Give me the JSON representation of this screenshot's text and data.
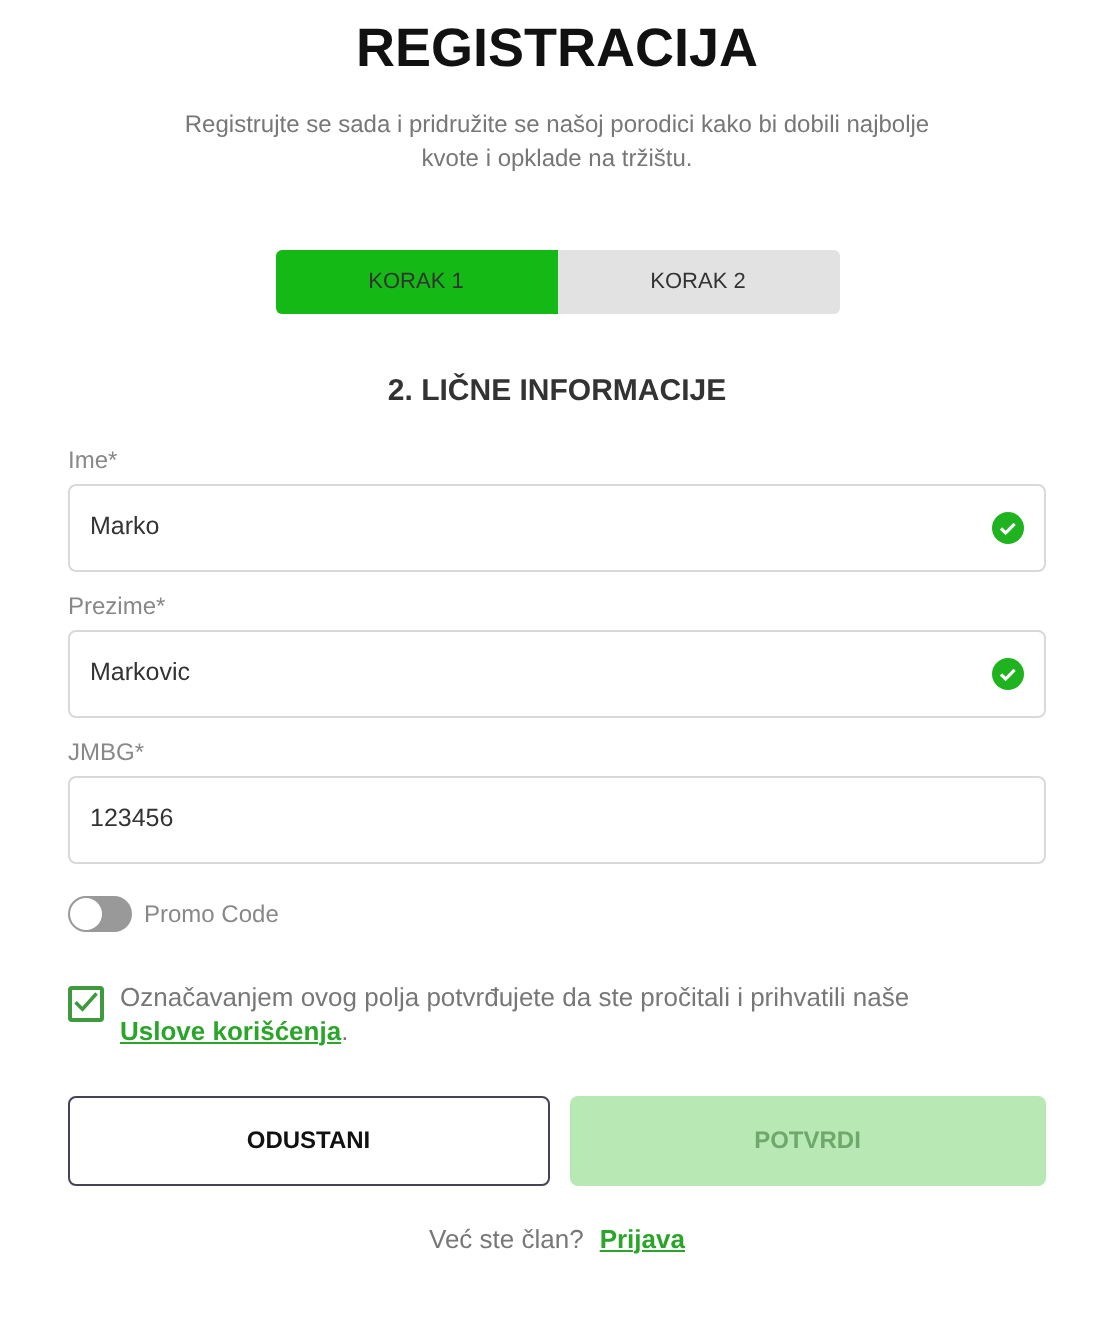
{
  "title": "REGISTRACIJA",
  "subtitle": "Registrujte se sada i pridružite se našoj porodici kako bi dobili najbolje kvote i opklade na tržištu.",
  "steps": [
    {
      "label": "KORAK 1",
      "selected": true
    },
    {
      "label": "KORAK 2",
      "selected": false
    }
  ],
  "section_title": "2. LIČNE INFORMACIJE",
  "fields": [
    {
      "label": "Ime*",
      "value": "Marko",
      "valid": true
    },
    {
      "label": "Prezime*",
      "value": "Markovic",
      "valid": true
    },
    {
      "label": "JMBG*",
      "value": "123456",
      "valid": false
    }
  ],
  "promo": {
    "label": "Promo Code",
    "on": false
  },
  "terms": {
    "checked": true,
    "text": "Označavanjem ovog polja potvrđujete da ste pročitali i prihvatili naše",
    "link": "Uslove korišćenja",
    "end": "."
  },
  "buttons": [
    {
      "label": "ODUSTANI",
      "kind": "outline",
      "disabled": false
    },
    {
      "label": "POTVRDI",
      "kind": "primary",
      "disabled": true
    }
  ],
  "footer": {
    "text": "Već ste član?",
    "link": "Prijava"
  }
}
